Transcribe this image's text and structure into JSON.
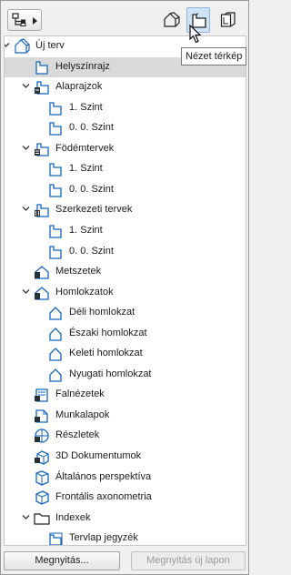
{
  "toolbar": {
    "tooltip": "Nézet térkép",
    "buttons": [
      {
        "icon": "project-map-icon"
      },
      {
        "icon": "view-map-icon"
      },
      {
        "icon": "layout-book-icon"
      }
    ]
  },
  "tree": {
    "items": [
      {
        "label": "Új terv",
        "icon": "project-house-icon",
        "level": 0,
        "twisty": "expanded"
      },
      {
        "label": "Helyszínrajz",
        "icon": "site-plan-icon",
        "level": 1,
        "twisty": "none",
        "selected": true
      },
      {
        "label": "Alaprajzok",
        "icon": "floor-plans-folder-icon",
        "level": 1,
        "twisty": "expanded"
      },
      {
        "label": "1. Szint",
        "icon": "floor-plan-icon",
        "level": 2,
        "twisty": "none"
      },
      {
        "label": "0. 0. Szint",
        "icon": "floor-plan-icon",
        "level": 2,
        "twisty": "none"
      },
      {
        "label": "Födémtervek",
        "icon": "ceiling-plans-folder-icon",
        "level": 1,
        "twisty": "expanded"
      },
      {
        "label": "1. Szint",
        "icon": "ceiling-plan-icon",
        "level": 2,
        "twisty": "none"
      },
      {
        "label": "0. 0. Szint",
        "icon": "ceiling-plan-icon",
        "level": 2,
        "twisty": "none"
      },
      {
        "label": "Szerkezeti tervek",
        "icon": "structural-plans-folder-icon",
        "level": 1,
        "twisty": "expanded"
      },
      {
        "label": "1. Szint",
        "icon": "structural-plan-icon",
        "level": 2,
        "twisty": "none"
      },
      {
        "label": "0. 0. Szint",
        "icon": "structural-plan-icon",
        "level": 2,
        "twisty": "none"
      },
      {
        "label": "Metszetek",
        "icon": "sections-icon",
        "level": 1,
        "twisty": "none"
      },
      {
        "label": "Homlokzatok",
        "icon": "elevations-icon",
        "level": 1,
        "twisty": "expanded"
      },
      {
        "label": "Déli homlokzat",
        "icon": "elevation-icon",
        "level": 2,
        "twisty": "none"
      },
      {
        "label": "Északi homlokzat",
        "icon": "elevation-icon",
        "level": 2,
        "twisty": "none"
      },
      {
        "label": "Keleti homlokzat",
        "icon": "elevation-icon",
        "level": 2,
        "twisty": "none"
      },
      {
        "label": "Nyugati homlokzat",
        "icon": "elevation-icon",
        "level": 2,
        "twisty": "none"
      },
      {
        "label": "Falnézetek",
        "icon": "interior-elevations-icon",
        "level": 1,
        "twisty": "none"
      },
      {
        "label": "Munkalapok",
        "icon": "worksheets-icon",
        "level": 1,
        "twisty": "none"
      },
      {
        "label": "Részletek",
        "icon": "details-icon",
        "level": 1,
        "twisty": "none"
      },
      {
        "label": "3D Dokumentumok",
        "icon": "3d-documents-icon",
        "level": 1,
        "twisty": "none"
      },
      {
        "label": "Általános perspektíva",
        "icon": "perspective-icon",
        "level": 1,
        "twisty": "none"
      },
      {
        "label": "Frontális axonometria",
        "icon": "axonometry-icon",
        "level": 1,
        "twisty": "none"
      },
      {
        "label": "Indexek",
        "icon": "indexes-folder-icon",
        "level": 1,
        "twisty": "expanded"
      },
      {
        "label": "Tervlap jegyzék",
        "icon": "drawing-list-icon",
        "level": 2,
        "twisty": "none"
      }
    ]
  },
  "footer": {
    "open_label": "Megnyitás...",
    "open_new_tab_label": "Megnyitás új lapon"
  },
  "colors": {
    "panel_bg": "#f0f0f0",
    "tree_bg": "#ffffff",
    "icon_blue": "#1565c0",
    "selection_bg": "#d9d9d9",
    "active_button_bg": "#cfe3f7"
  }
}
